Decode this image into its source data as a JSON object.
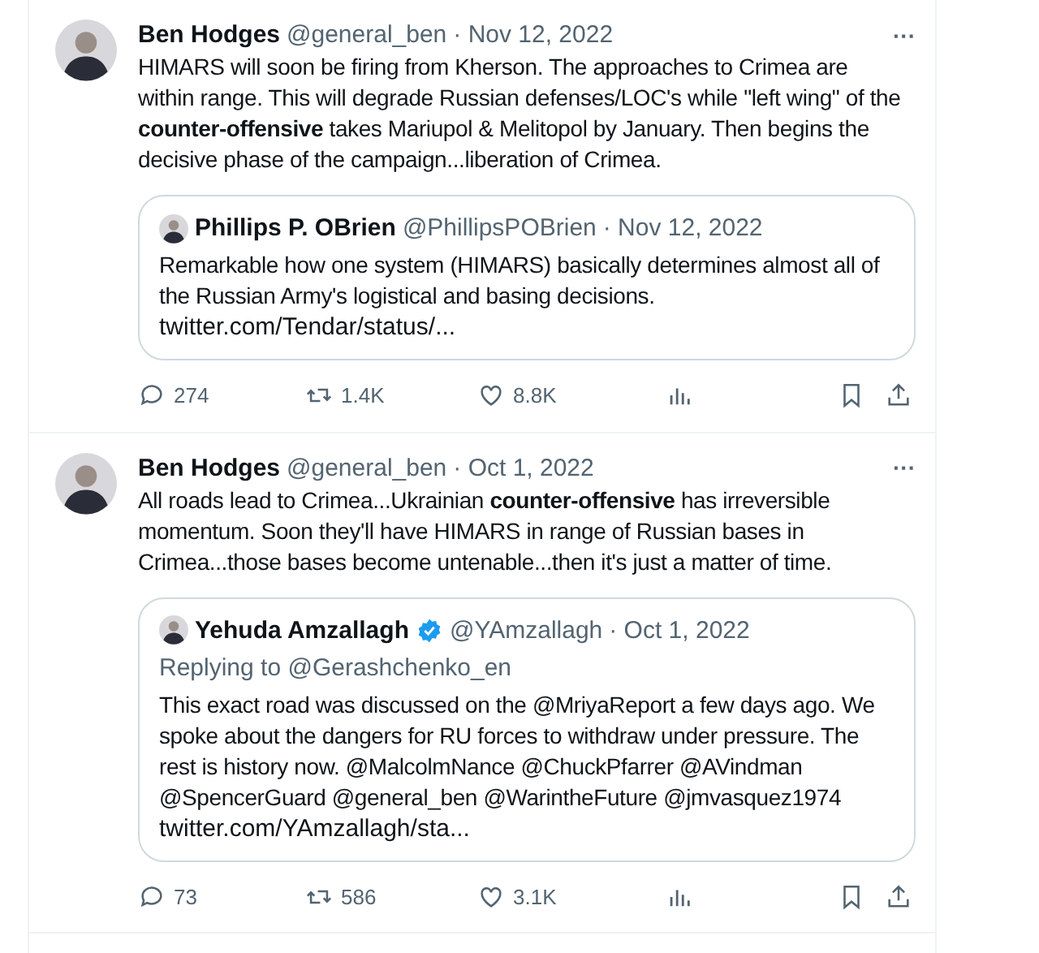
{
  "tweets": [
    {
      "author": {
        "name": "Ben Hodges",
        "handle": "@general_ben",
        "date": "· Nov 12, 2022"
      },
      "text": "HIMARS will soon be firing from Kherson. The approaches to Crimea are within range. This will degrade Russian defenses/LOC's while \"left wing\" of the **counter-offensive** takes Mariupol & Melitopol by January. Then begins the decisive phase of the campaign...liberation of Crimea.",
      "more": "···",
      "quote": {
        "name": "Phillips P. OBrien",
        "verified": false,
        "handle": "@PhillipsPOBrien",
        "date": "· Nov 12, 2022",
        "text": "Remarkable how one system (HIMARS) basically determines almost all of the Russian Army's logistical and basing decisions.",
        "link": "twitter.com/Tendar/status/..."
      },
      "stats": {
        "replies": "274",
        "reposts": "1.4K",
        "likes": "8.8K"
      }
    },
    {
      "author": {
        "name": "Ben Hodges",
        "handle": "@general_ben",
        "date": "· Oct 1, 2022"
      },
      "text": "All roads lead to Crimea...Ukrainian **counter-offensive** has irreversible momentum.  Soon they'll have HIMARS in range of Russian bases in Crimea...those bases become untenable...then it's just a matter of time.",
      "more": "···",
      "quote": {
        "name": "Yehuda Amzallagh",
        "verified": true,
        "handle": "@YAmzallagh",
        "date": "· Oct 1, 2022",
        "replying_to": "Replying to @Gerashchenko_en",
        "text": "This exact road was discussed on the @MriyaReport a few days ago. We spoke about the dangers for RU forces to withdraw under pressure. The rest is history now. @MalcolmNance @ChuckPfarrer @AVindman @SpencerGuard @general_ben @WarintheFuture @jmvasquez1974",
        "link": "twitter.com/YAmzallagh/sta..."
      },
      "stats": {
        "replies": "73",
        "reposts": "586",
        "likes": "3.1K"
      }
    }
  ]
}
